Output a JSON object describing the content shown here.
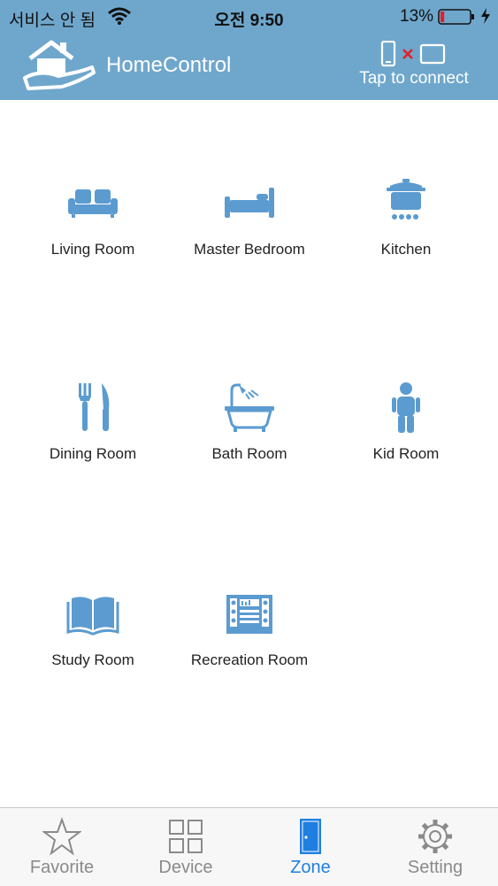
{
  "status_bar": {
    "carrier": "서비스 안 됨",
    "time": "오전 9:50",
    "battery_percent": "13%",
    "battery_level": 0.13
  },
  "header": {
    "title": "HomeControl",
    "connect_label": "Tap to connect",
    "logo_icon": "house-hand-icon",
    "connection_icon": "phone-disconnected-tablet-icon"
  },
  "zones": [
    {
      "label": "Living Room",
      "icon": "sofa-icon"
    },
    {
      "label": "Master Bedroom",
      "icon": "bed-icon"
    },
    {
      "label": "Kitchen",
      "icon": "cooking-pot-icon"
    },
    {
      "label": "Dining Room",
      "icon": "fork-knife-icon"
    },
    {
      "label": "Bath Room",
      "icon": "bathtub-icon"
    },
    {
      "label": "Kid Room",
      "icon": "child-icon"
    },
    {
      "label": "Study Room",
      "icon": "book-icon"
    },
    {
      "label": "Recreation Room",
      "icon": "stereo-icon"
    }
  ],
  "tabs": [
    {
      "label": "Favorite",
      "icon": "star-icon",
      "active": false
    },
    {
      "label": "Device",
      "icon": "grid-icon",
      "active": false
    },
    {
      "label": "Zone",
      "icon": "door-icon",
      "active": true
    },
    {
      "label": "Setting",
      "icon": "gear-icon",
      "active": false
    }
  ],
  "colors": {
    "header_bg": "#6fa7cc",
    "icon_blue": "#5b9bd0",
    "active_tab": "#1f7fe0",
    "inactive_tab": "#8a8a8a",
    "disconnect_x": "#e0202a",
    "battery_low": "#e0202a"
  }
}
